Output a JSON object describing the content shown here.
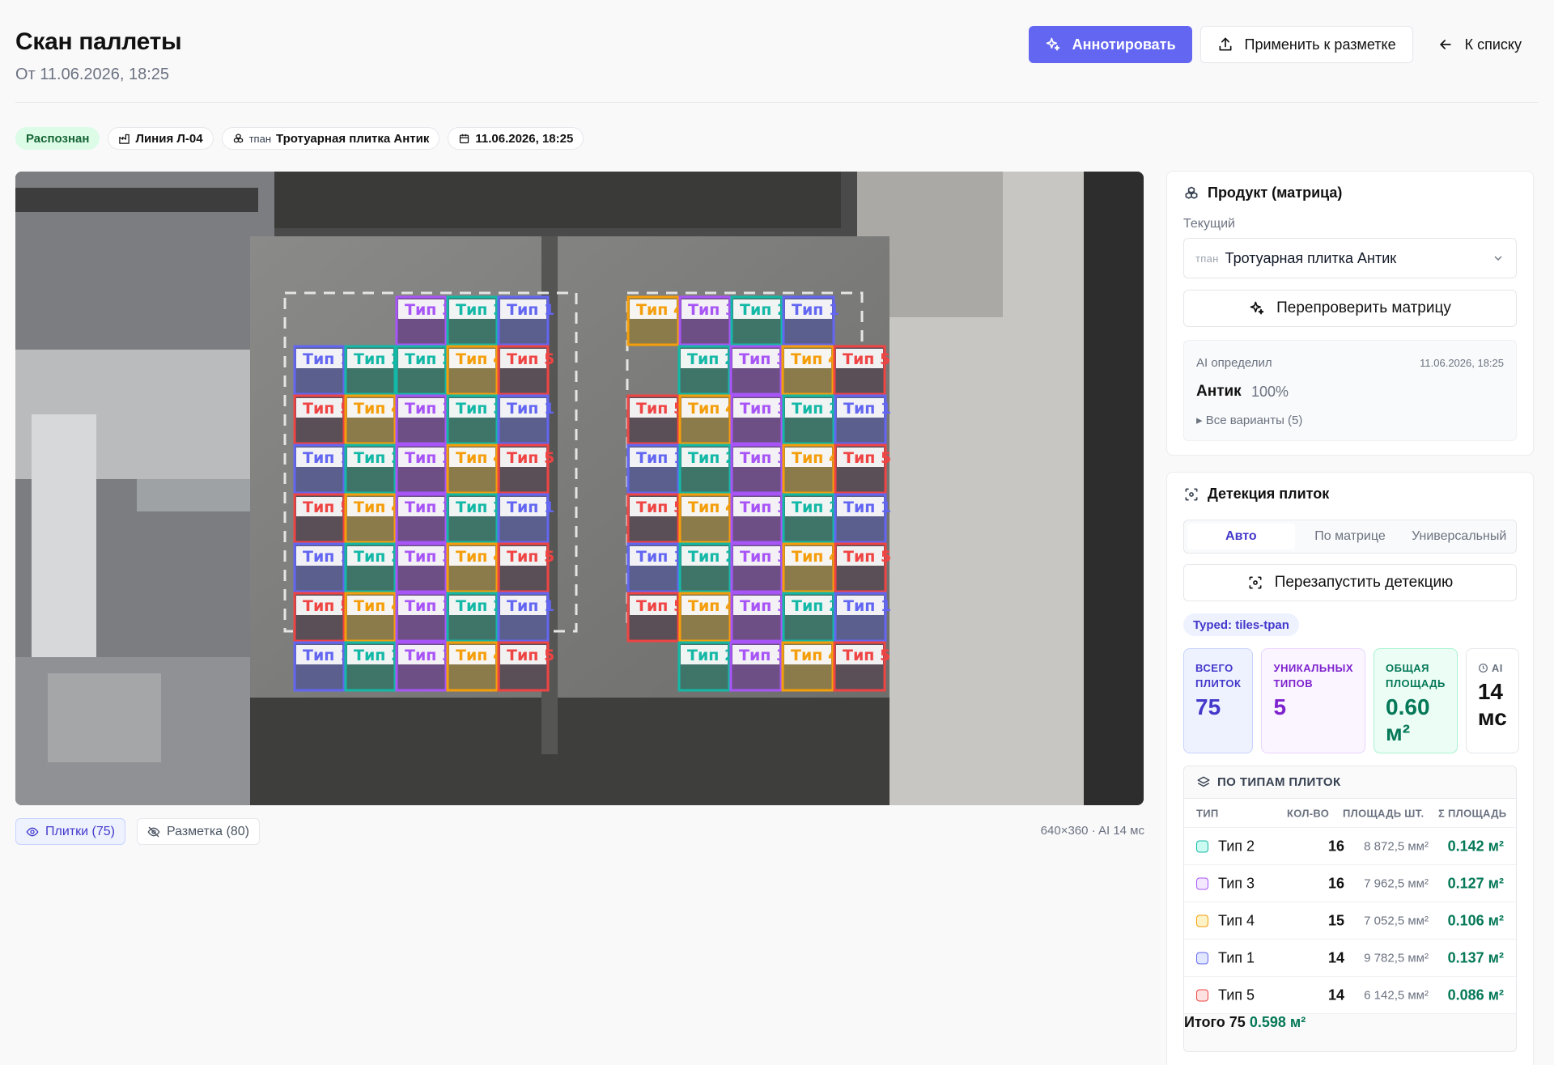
{
  "page": {
    "title": "Скан паллеты",
    "subtitle": "От 11.06.2026, 18:25"
  },
  "actions": {
    "annotate": "Аннотировать",
    "apply": "Применить к разметке",
    "back": "К списку"
  },
  "chips": {
    "status": "Распознан",
    "line": "Линия Л-04",
    "product_tag": "тпан",
    "product": "Тротуарная плитка Антик",
    "datetime": "11.06.2026, 18:25"
  },
  "viewer": {
    "toggle_tiles": "Плитки (75)",
    "toggle_markup": "Разметка (80)",
    "info": "640×360 · AI 14 мс"
  },
  "overlay_labels": [
    "Тип 1",
    "Тип 2",
    "Тип 3",
    "Тип 4",
    "Тип 5"
  ],
  "overlay_colors": {
    "Тип 1": "#6366f1",
    "Тип 2": "#14b8a6",
    "Тип 3": "#a855f7",
    "Тип 4": "#f59e0b",
    "Тип 5": "#ef4444"
  },
  "product_card": {
    "title": "Продукт (матрица)",
    "current_label": "Текущий",
    "select_tag": "тпан",
    "select_value": "Тротуарная плитка Антик",
    "recheck": "Перепроверить матрицу",
    "ai_label": "AI определил",
    "ai_time": "11.06.2026, 18:25",
    "ai_name": "Антик",
    "ai_conf": "100%",
    "ai_variants": "▸ Все варианты (5)"
  },
  "detection_card": {
    "title": "Детекция плиток",
    "tabs": [
      "Авто",
      "По матрице",
      "Универсальный"
    ],
    "active_tab": "Авто",
    "rerun": "Перезапустить детекцию",
    "typed": "Typed: tiles-tpan",
    "stats": {
      "total_label": "Всего плиток",
      "total_value": "75",
      "unique_label": "Уникальных типов",
      "unique_value": "5",
      "area_label": "Общая площадь",
      "area_value": "0.60 м²",
      "ai_label": "AI",
      "ai_value": "14 мс"
    },
    "table": {
      "heading": "ПО ТИПАМ ПЛИТОК",
      "columns": [
        "ТИП",
        "КОЛ-ВО",
        "ПЛОЩАДЬ ШТ.",
        "Σ ПЛОЩАДЬ"
      ],
      "rows": [
        {
          "name": "Тип 2",
          "qty": "16",
          "area": "8 872,5 мм²",
          "total": "0.142 м²",
          "color": "#14b8a6",
          "bg": "#ccfbf1"
        },
        {
          "name": "Тип 3",
          "qty": "16",
          "area": "7 962,5 мм²",
          "total": "0.127 м²",
          "color": "#a855f7",
          "bg": "#f3e8ff"
        },
        {
          "name": "Тип 4",
          "qty": "15",
          "area": "7 052,5 мм²",
          "total": "0.106 м²",
          "color": "#f59e0b",
          "bg": "#fef3c7"
        },
        {
          "name": "Тип 1",
          "qty": "14",
          "area": "9 782,5 мм²",
          "total": "0.137 м²",
          "color": "#6366f1",
          "bg": "#e0e7ff"
        },
        {
          "name": "Тип 5",
          "qty": "14",
          "area": "6 142,5 мм²",
          "total": "0.086 м²",
          "color": "#ef4444",
          "bg": "#fee2e2"
        }
      ],
      "footer": {
        "name": "Итого",
        "qty": "75",
        "total": "0.598 м²"
      }
    }
  }
}
